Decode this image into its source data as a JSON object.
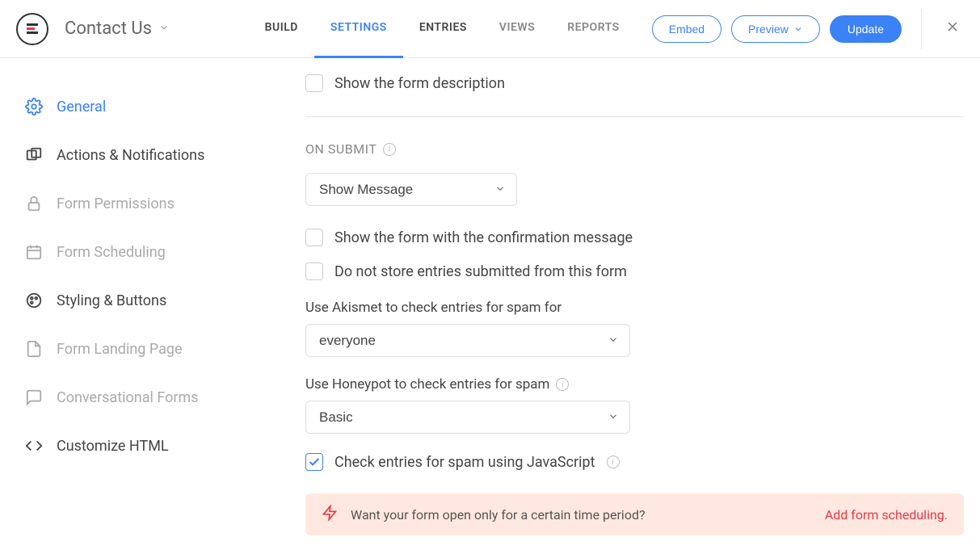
{
  "header": {
    "form_title": "Contact Us",
    "tabs": {
      "build": "BUILD",
      "settings": "SETTINGS",
      "entries": "ENTRIES",
      "views": "VIEWS",
      "reports": "REPORTS"
    },
    "embed": "Embed",
    "preview": "Preview",
    "update": "Update"
  },
  "sidebar": {
    "general": "General",
    "actions": "Actions & Notifications",
    "permissions": "Form Permissions",
    "scheduling": "Form Scheduling",
    "styling": "Styling & Buttons",
    "landing": "Form Landing Page",
    "conversational": "Conversational Forms",
    "customize_html": "Customize HTML"
  },
  "main": {
    "show_description": "Show the form description",
    "on_submit_title": "ON SUBMIT",
    "on_submit_select": "Show Message",
    "show_with_confirmation": "Show the form with the confirmation message",
    "do_not_store": "Do not store entries submitted from this form",
    "akismet_label": "Use Akismet to check entries for spam for",
    "akismet_value": "everyone",
    "honeypot_label": "Use Honeypot to check entries for spam",
    "honeypot_value": "Basic",
    "js_check": "Check entries for spam using JavaScript",
    "banner_text": "Want your form open only for a certain time period?",
    "banner_link": "Add form scheduling."
  }
}
